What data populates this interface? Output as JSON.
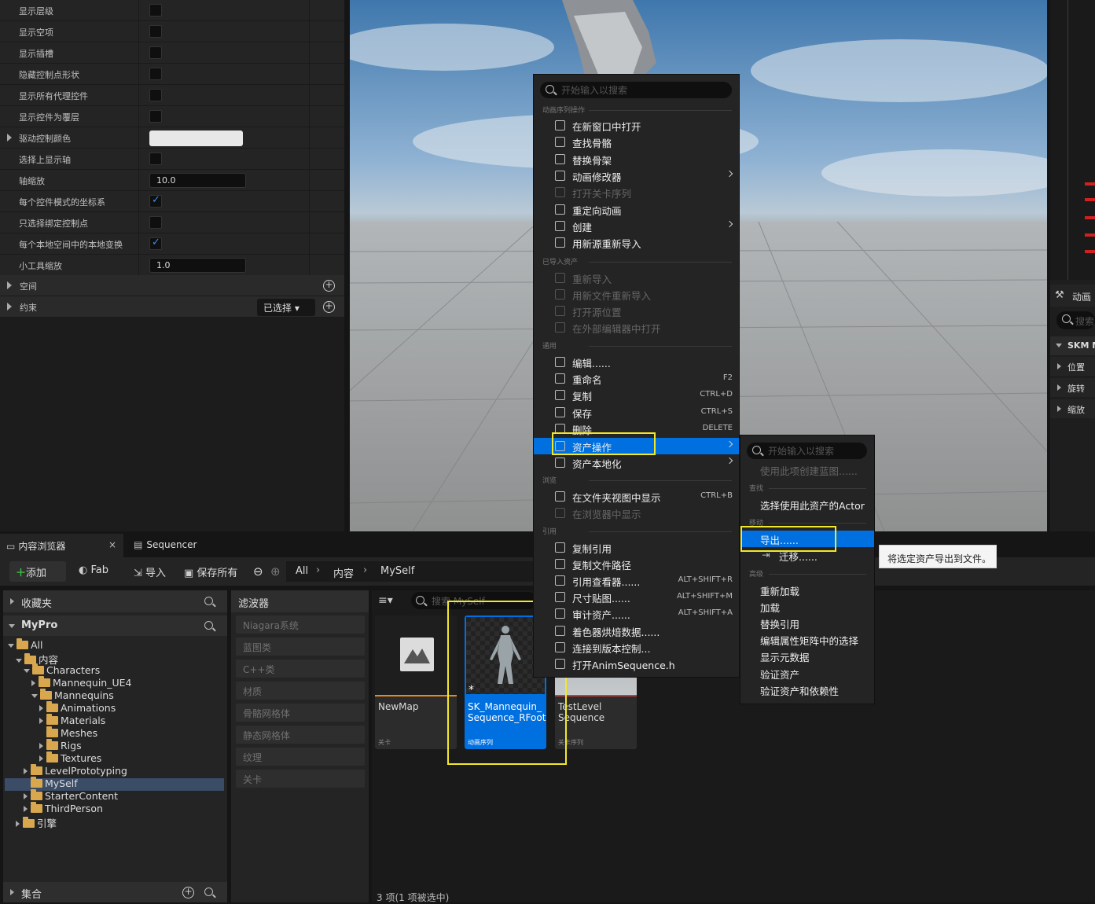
{
  "details": {
    "rows": [
      {
        "label": "显示层级",
        "type": "check",
        "checked": false
      },
      {
        "label": "显示空项",
        "type": "check",
        "checked": false
      },
      {
        "label": "显示插槽",
        "type": "check",
        "checked": false
      },
      {
        "label": "隐藏控制点形状",
        "type": "check",
        "checked": false
      },
      {
        "label": "显示所有代理控件",
        "type": "check",
        "checked": false
      },
      {
        "label": "显示控件为覆层",
        "type": "check",
        "checked": false
      },
      {
        "label": "驱动控制颜色",
        "type": "color"
      },
      {
        "label": "选择上显示轴",
        "type": "check",
        "checked": false
      },
      {
        "label": "轴缩放",
        "type": "number",
        "value": "10.0"
      },
      {
        "label": "每个控件模式的坐标系",
        "type": "check",
        "checked": true
      },
      {
        "label": "只选择绑定控制点",
        "type": "check",
        "checked": false
      },
      {
        "label": "每个本地空间中的本地变换",
        "type": "check",
        "checked": true
      },
      {
        "label": "小工具缩放",
        "type": "number",
        "value": "1.0"
      }
    ],
    "space_label": "空间",
    "constraint_label": "约束",
    "selected_dropdown": "已选择"
  },
  "right_panel": {
    "title": "动画",
    "search": "搜索",
    "section": "SKM M",
    "items": [
      "位置",
      "旋转",
      "缩放"
    ]
  },
  "tabs": {
    "content_browser": "内容浏览器",
    "sequencer": "Sequencer"
  },
  "toolbar": {
    "add": "添加",
    "fab": "Fab",
    "import": "导入",
    "save_all": "保存所有",
    "path": [
      "All",
      "内容",
      "MySelf"
    ]
  },
  "tree": {
    "favorites": "收藏夹",
    "project": "MyPro",
    "nodes": [
      "All",
      "内容",
      "Characters",
      "Mannequin_UE4",
      "Mannequins",
      "Animations",
      "Materials",
      "Meshes",
      "Rigs",
      "Textures",
      "LevelPrototyping",
      "MySelf",
      "StarterContent",
      "ThirdPerson",
      "引擎"
    ],
    "collections": "集合"
  },
  "filters": {
    "title": "滤波器",
    "items": [
      "Niagara系统",
      "蓝图类",
      "C++类",
      "材质",
      "骨骼网格体",
      "静态网格体",
      "纹理",
      "关卡"
    ]
  },
  "assets": {
    "search_placeholder": "搜索 MySelf",
    "cards": [
      {
        "name": "NewMap",
        "type": "关卡"
      },
      {
        "name": "SK_Mannequin_Sequence_RFoot",
        "line1": "SK_Mannequin_",
        "line2": "Sequence_RFoot",
        "type": "动画序列"
      },
      {
        "name": "TestLevelSequence",
        "line1": "TestLevel",
        "line2": "Sequence",
        "type": "关卡序列"
      }
    ],
    "status": "3 项(1 项被选中)"
  },
  "context_menu": {
    "search_placeholder": "开始输入以搜索",
    "sections": {
      "anim": "动画序列操作",
      "imported": "已导入资产",
      "common": "通用",
      "browse": "浏览",
      "reference": "引用"
    },
    "anim_items": [
      {
        "label": "在新窗口中打开"
      },
      {
        "label": "查找骨骼"
      },
      {
        "label": "替换骨架"
      },
      {
        "label": "动画修改器"
      },
      {
        "label": "打开关卡序列"
      },
      {
        "label": "重定向动画"
      },
      {
        "label": "创建"
      },
      {
        "label": "用新源重新导入"
      }
    ],
    "imported_items": [
      "重新导入",
      "用新文件重新导入",
      "打开源位置",
      "在外部编辑器中打开"
    ],
    "common_items": [
      {
        "label": "编辑......",
        "shortcut": ""
      },
      {
        "label": "重命名",
        "shortcut": "F2"
      },
      {
        "label": "复制",
        "shortcut": "CTRL+D"
      },
      {
        "label": "保存",
        "shortcut": "CTRL+S"
      },
      {
        "label": "删除",
        "shortcut": "DELETE"
      },
      {
        "label": "资产操作",
        "shortcut": ""
      },
      {
        "label": "资产本地化",
        "shortcut": ""
      }
    ],
    "browse_items": [
      {
        "label": "在文件夹视图中显示",
        "shortcut": "CTRL+B"
      },
      {
        "label": "在浏览器中显示",
        "shortcut": ""
      }
    ],
    "reference_items": [
      {
        "label": "复制引用",
        "shortcut": ""
      },
      {
        "label": "复制文件路径",
        "shortcut": ""
      },
      {
        "label": "引用查看器......",
        "shortcut": "ALT+SHIFT+R"
      },
      {
        "label": "尺寸贴图......",
        "shortcut": "ALT+SHIFT+M"
      },
      {
        "label": "审计资产......",
        "shortcut": "ALT+SHIFT+A"
      },
      {
        "label": "着色器烘焙数据......",
        "shortcut": ""
      },
      {
        "label": "连接到版本控制...",
        "shortcut": ""
      },
      {
        "label": "打开AnimSequence.h",
        "shortcut": ""
      }
    ]
  },
  "submenu": {
    "search_placeholder": "开始输入以搜索",
    "create_bp": "使用此项创建蓝图......",
    "sections": {
      "find": "查找",
      "move": "移动",
      "advanced": "高级"
    },
    "find_item": "选择使用此资产的Actor",
    "export": "导出......",
    "migrate": "迁移......",
    "advanced_items": [
      "重新加载",
      "加载",
      "替换引用",
      "编辑属性矩阵中的选择",
      "显示元数据",
      "验证资产",
      "验证资产和依赖性"
    ]
  },
  "tooltip": "将选定资产导出到文件。",
  "colors": {
    "accent": "#0070e0",
    "highlight": "#f2e82a",
    "folder": "#d9a84e"
  }
}
